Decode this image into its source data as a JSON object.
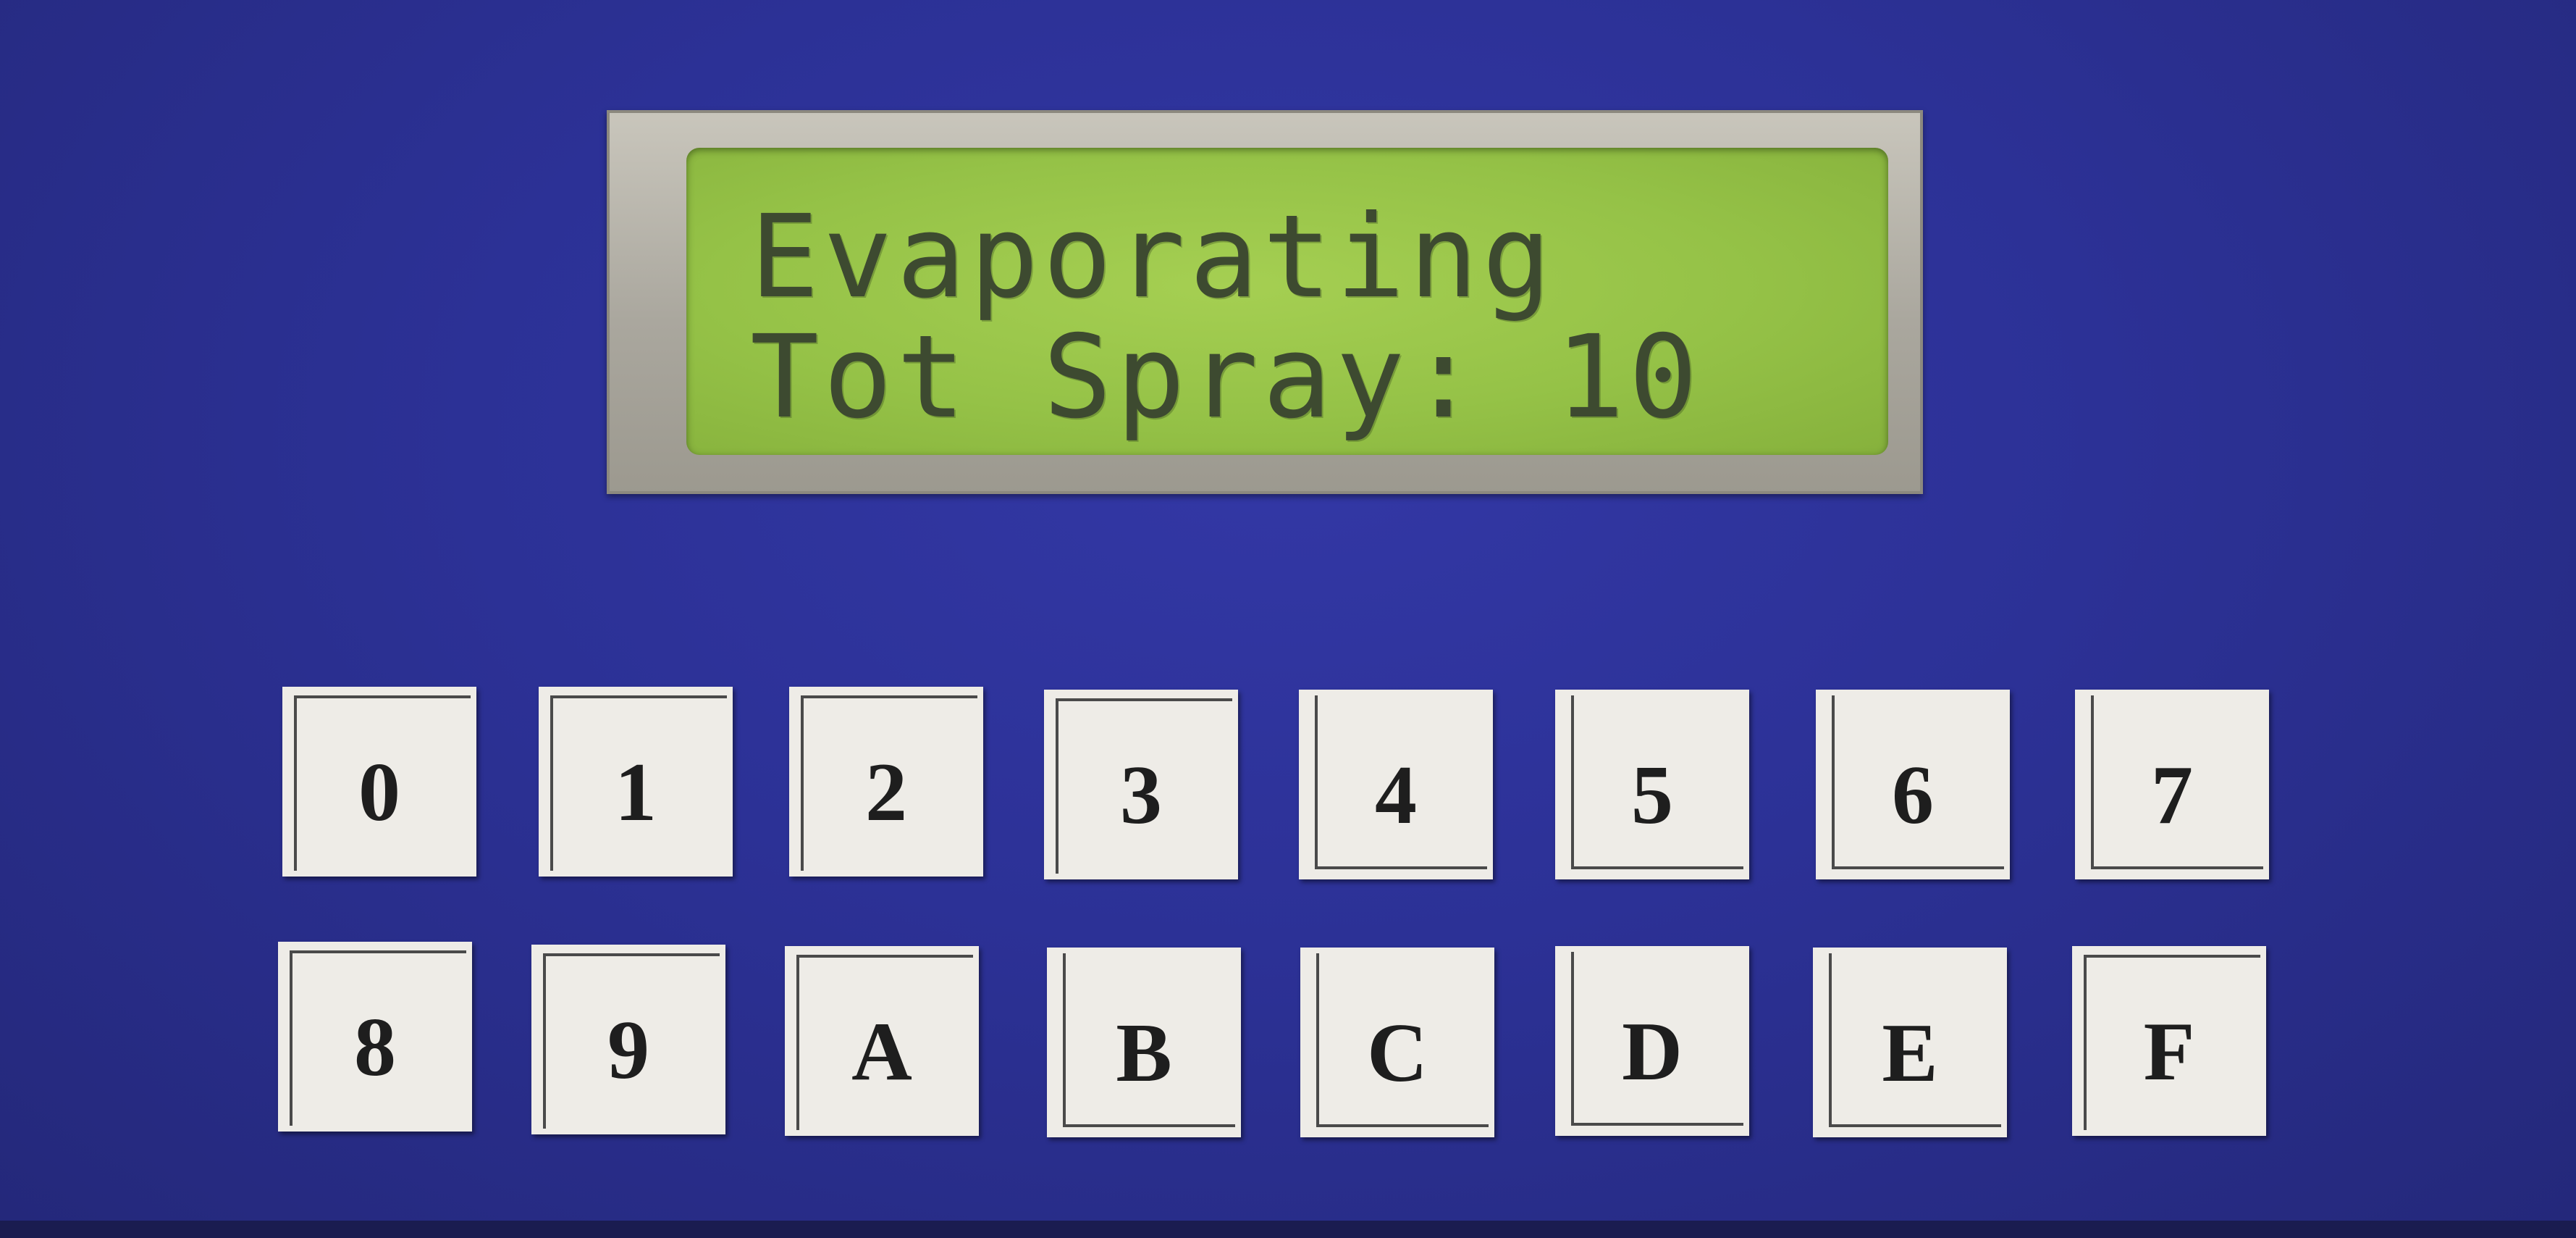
{
  "display": {
    "line1": "Evaporating",
    "line2": "Tot Spray: 10"
  },
  "keypad": {
    "row1": [
      "0",
      "1",
      "2",
      "3",
      "4",
      "5",
      "6",
      "7"
    ],
    "row2": [
      "8",
      "9",
      "A",
      "B",
      "C",
      "D",
      "E",
      "F"
    ]
  },
  "colors": {
    "panel": "#2c3196",
    "lcd_background": "#95c247",
    "lcd_text": "#3d4a30",
    "key_face": "#eeece7"
  }
}
